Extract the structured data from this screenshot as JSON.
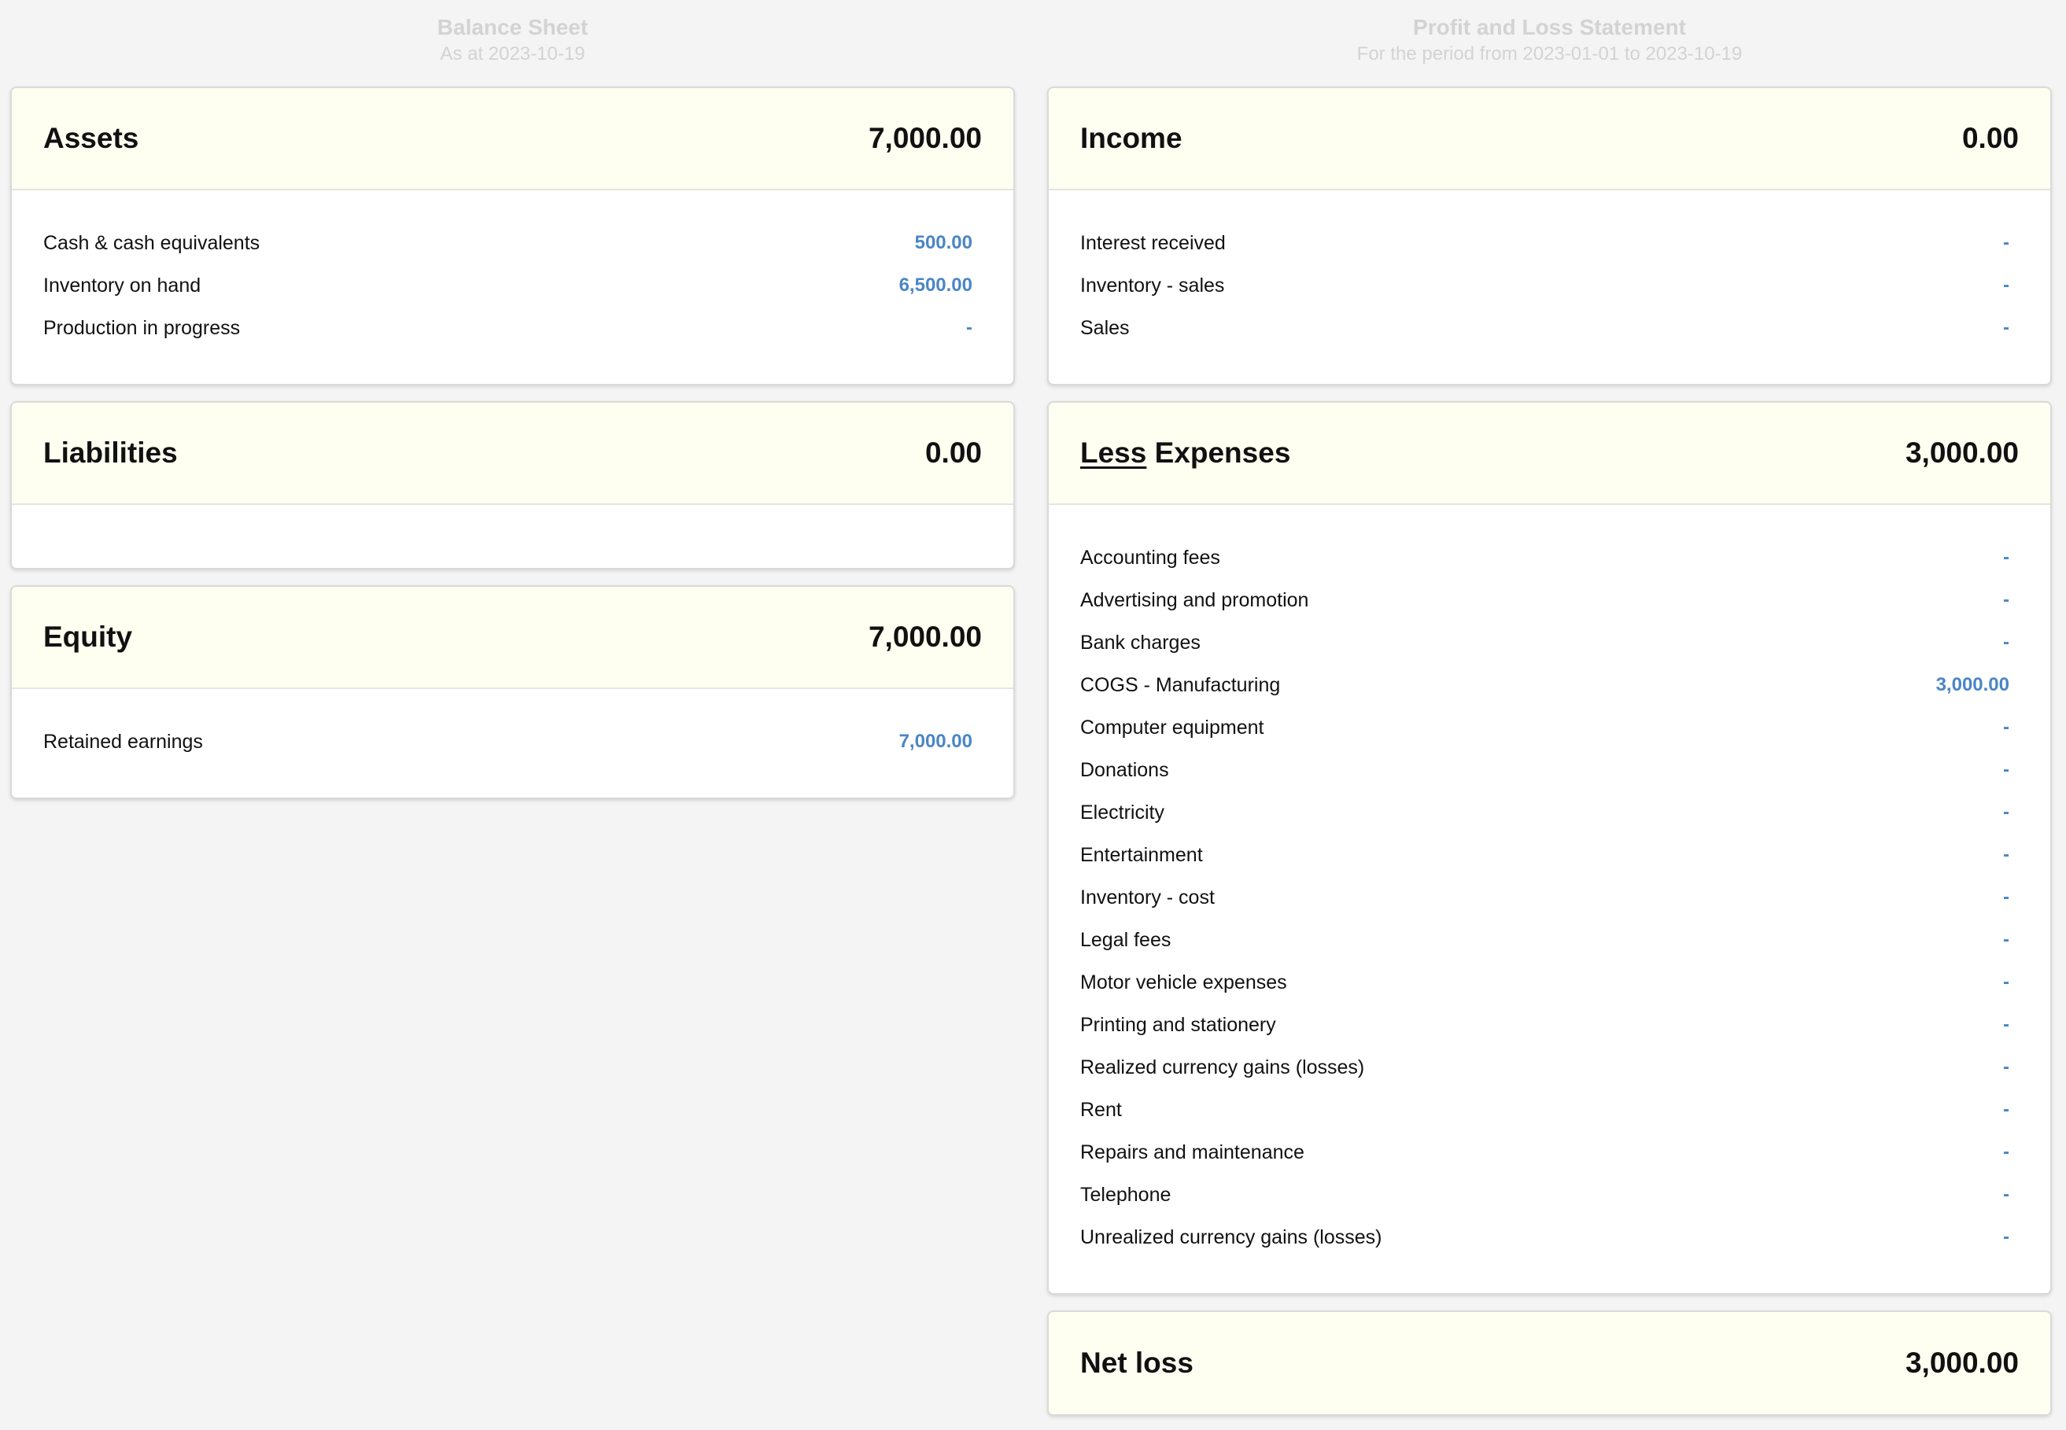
{
  "balance_sheet": {
    "title": "Balance Sheet",
    "subtitle": "As at 2023-10-19",
    "assets": {
      "title": "Assets",
      "total": "7,000.00",
      "rows": [
        {
          "label": "Cash & cash equivalents",
          "value": "500.00"
        },
        {
          "label": "Inventory on hand",
          "value": "6,500.00"
        },
        {
          "label": "Production in progress",
          "value": "-"
        }
      ]
    },
    "liabilities": {
      "title": "Liabilities",
      "total": "0.00"
    },
    "equity": {
      "title": "Equity",
      "total": "7,000.00",
      "rows": [
        {
          "label": "Retained earnings",
          "value": "7,000.00"
        }
      ]
    }
  },
  "profit_loss": {
    "title": "Profit and Loss Statement",
    "subtitle": "For the period from 2023-01-01 to 2023-10-19",
    "income": {
      "title": "Income",
      "total": "0.00",
      "rows": [
        {
          "label": "Interest received",
          "value": "-"
        },
        {
          "label": "Inventory - sales",
          "value": "-"
        },
        {
          "label": "Sales",
          "value": "-"
        }
      ]
    },
    "expenses": {
      "title_prefix": "Less",
      "title_suffix": " Expenses",
      "total": "3,000.00",
      "rows": [
        {
          "label": "Accounting fees",
          "value": "-"
        },
        {
          "label": "Advertising and promotion",
          "value": "-"
        },
        {
          "label": "Bank charges",
          "value": "-"
        },
        {
          "label": "COGS - Manufacturing",
          "value": "3,000.00"
        },
        {
          "label": "Computer equipment",
          "value": "-"
        },
        {
          "label": "Donations",
          "value": "-"
        },
        {
          "label": "Electricity",
          "value": "-"
        },
        {
          "label": "Entertainment",
          "value": "-"
        },
        {
          "label": "Inventory - cost",
          "value": "-"
        },
        {
          "label": "Legal fees",
          "value": "-"
        },
        {
          "label": "Motor vehicle expenses",
          "value": "-"
        },
        {
          "label": "Printing and stationery",
          "value": "-"
        },
        {
          "label": "Realized currency gains (losses)",
          "value": "-"
        },
        {
          "label": "Rent",
          "value": "-"
        },
        {
          "label": "Repairs and maintenance",
          "value": "-"
        },
        {
          "label": "Telephone",
          "value": "-"
        },
        {
          "label": "Unrealized currency gains (losses)",
          "value": "-"
        }
      ]
    },
    "net": {
      "title": "Net loss",
      "total": "3,000.00"
    }
  },
  "colors": {
    "page_background": "#f4f4f4",
    "card_header_background": "#fffff1",
    "link_value": "#4a86c5",
    "muted_title": "#d3d3d3"
  }
}
